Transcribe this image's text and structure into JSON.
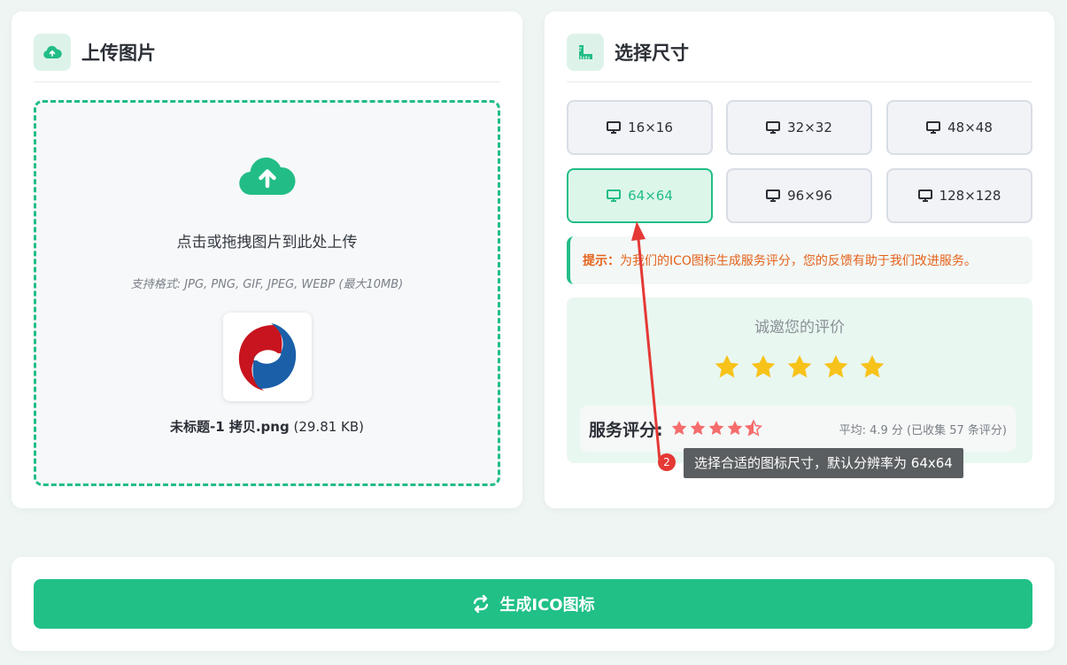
{
  "upload": {
    "title": "上传图片",
    "drop_text": "点击或拖拽图片到此处上传",
    "hint": "支持格式: JPG, PNG, GIF, JPEG, WEBP (最大10MB)",
    "file_name": "未标题-1 拷贝.png",
    "file_size": " (29.81 KB)"
  },
  "sizes": {
    "title": "选择尺寸",
    "options": [
      "16×16",
      "32×32",
      "48×48",
      "64×64",
      "96×96",
      "128×128"
    ],
    "selected": "64×64"
  },
  "tip": {
    "label": "提示：",
    "text": "为我们的ICO图标生成服务评分，您的反馈有助于我们改进服务。"
  },
  "rating": {
    "title": "诚邀您的评价",
    "score_label": "服务评分:",
    "average": "平均: 4.9 分 (已收集 57 条评分)",
    "score": 4.5
  },
  "generate": {
    "label": "生成ICO图标"
  },
  "annotation": {
    "step": "2",
    "text": "选择合适的图标尺寸，默认分辨率为 64x64"
  },
  "colors": {
    "accent": "#22bd86",
    "star": "#f7c31a",
    "mini_star": "#f56c6c",
    "tip_text": "#e5621c",
    "annotation_red": "#e53935"
  }
}
